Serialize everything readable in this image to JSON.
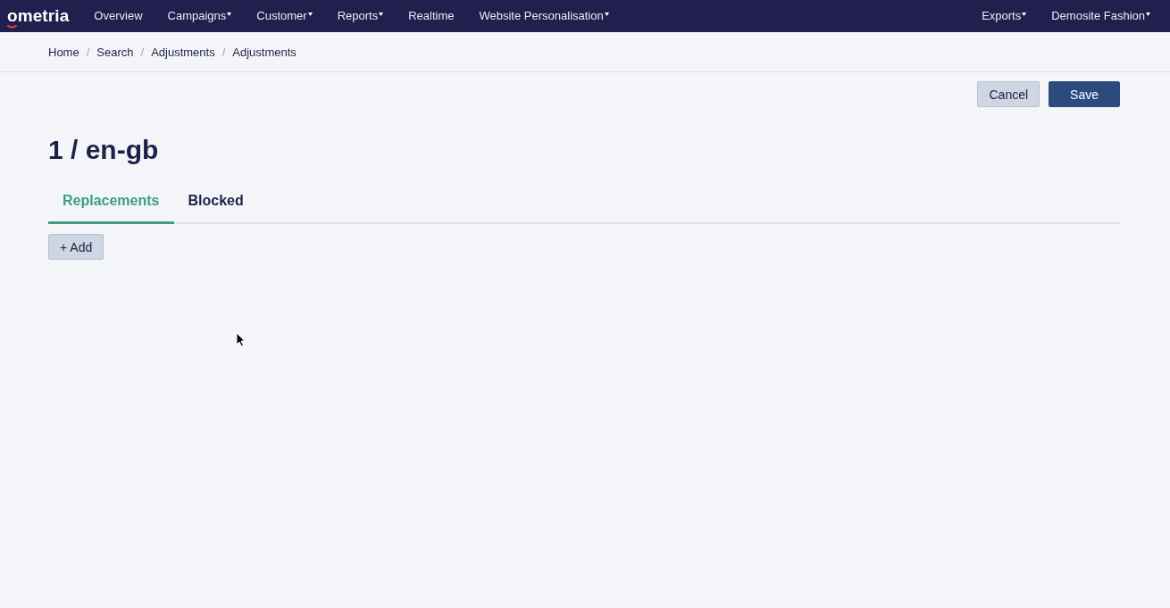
{
  "nav": {
    "logo": "ometria",
    "items": [
      {
        "label": "Overview",
        "has_menu": false
      },
      {
        "label": "Campaigns",
        "has_menu": true
      },
      {
        "label": "Customer",
        "has_menu": true
      },
      {
        "label": "Reports",
        "has_menu": true
      },
      {
        "label": "Realtime",
        "has_menu": false
      },
      {
        "label": "Website Personalisation",
        "has_menu": true
      }
    ],
    "right_items": [
      {
        "label": "Exports",
        "has_menu": true
      },
      {
        "label": "Demosite Fashion",
        "has_menu": true
      }
    ]
  },
  "breadcrumb": {
    "separator": "/",
    "items": [
      "Home",
      "Search",
      "Adjustments",
      "Adjustments"
    ]
  },
  "actions": [
    {
      "label": "Cancel",
      "kind": "secondary"
    },
    {
      "label": "Save",
      "kind": "primary"
    }
  ],
  "title": "1 / en-gb",
  "tabs": [
    {
      "label": "Replacements",
      "selected": true
    },
    {
      "label": "Blocked",
      "selected": false
    }
  ],
  "add_button": {
    "label": "+ Add"
  }
}
